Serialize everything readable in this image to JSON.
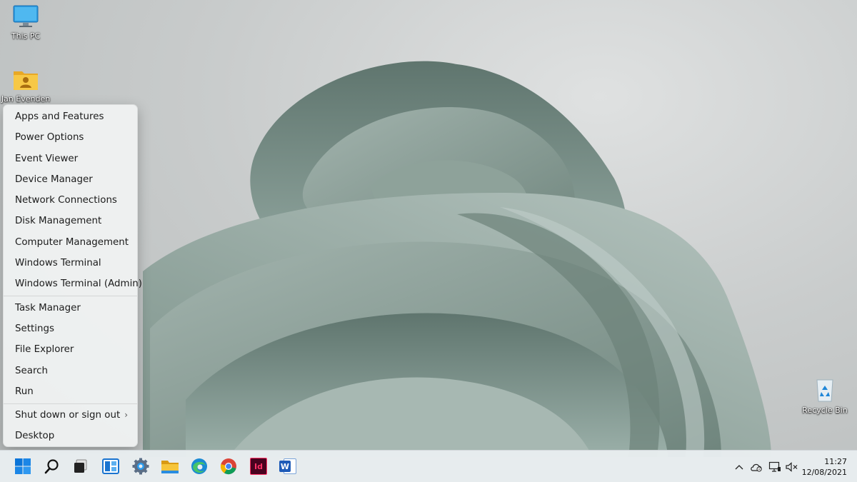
{
  "desktop": {
    "icons": [
      {
        "label": "This PC",
        "icon": "monitor-icon"
      },
      {
        "label": "Jan Evenden",
        "icon": "user-folder-icon"
      },
      {
        "label": "Recycle Bin",
        "icon": "recycle-bin-icon"
      }
    ]
  },
  "menu": {
    "groups": [
      [
        "Apps and Features",
        "Power Options",
        "Event Viewer",
        "Device Manager",
        "Network Connections",
        "Disk Management",
        "Computer Management",
        "Windows Terminal",
        "Windows Terminal (Admin)"
      ],
      [
        "Task Manager",
        "Settings",
        "File Explorer",
        "Search",
        "Run"
      ],
      [
        "Shut down or sign out",
        "Desktop"
      ]
    ],
    "submenu_indicator": "›"
  },
  "taskbar": {
    "apps": [
      {
        "name": "start-button",
        "icon": "windows-logo-icon"
      },
      {
        "name": "search-button",
        "icon": "search-icon"
      },
      {
        "name": "task-view-button",
        "icon": "task-view-icon"
      },
      {
        "name": "widgets-button",
        "icon": "widgets-icon"
      },
      {
        "name": "settings-app",
        "icon": "gear-icon"
      },
      {
        "name": "file-explorer-app",
        "icon": "folder-icon"
      },
      {
        "name": "edge-app",
        "icon": "edge-icon"
      },
      {
        "name": "chrome-app",
        "icon": "chrome-icon"
      },
      {
        "name": "indesign-app",
        "icon": "indesign-icon",
        "text": "Id"
      },
      {
        "name": "word-app",
        "icon": "word-icon",
        "text": "W"
      }
    ],
    "tray": [
      {
        "name": "show-hidden-icons",
        "icon": "chevron-up-icon"
      },
      {
        "name": "onedrive-tray",
        "icon": "cloud-icon"
      },
      {
        "name": "network-tray",
        "icon": "network-icon"
      },
      {
        "name": "volume-tray",
        "icon": "speaker-muted-icon"
      }
    ],
    "clock": {
      "time": "11:27",
      "date": "12/08/2021"
    }
  },
  "colors": {
    "accent": "#0067c0",
    "menu_bg": "#f0f2f2",
    "taskbar_bg": "#e8edf0",
    "bloom": "#8fa39c"
  }
}
